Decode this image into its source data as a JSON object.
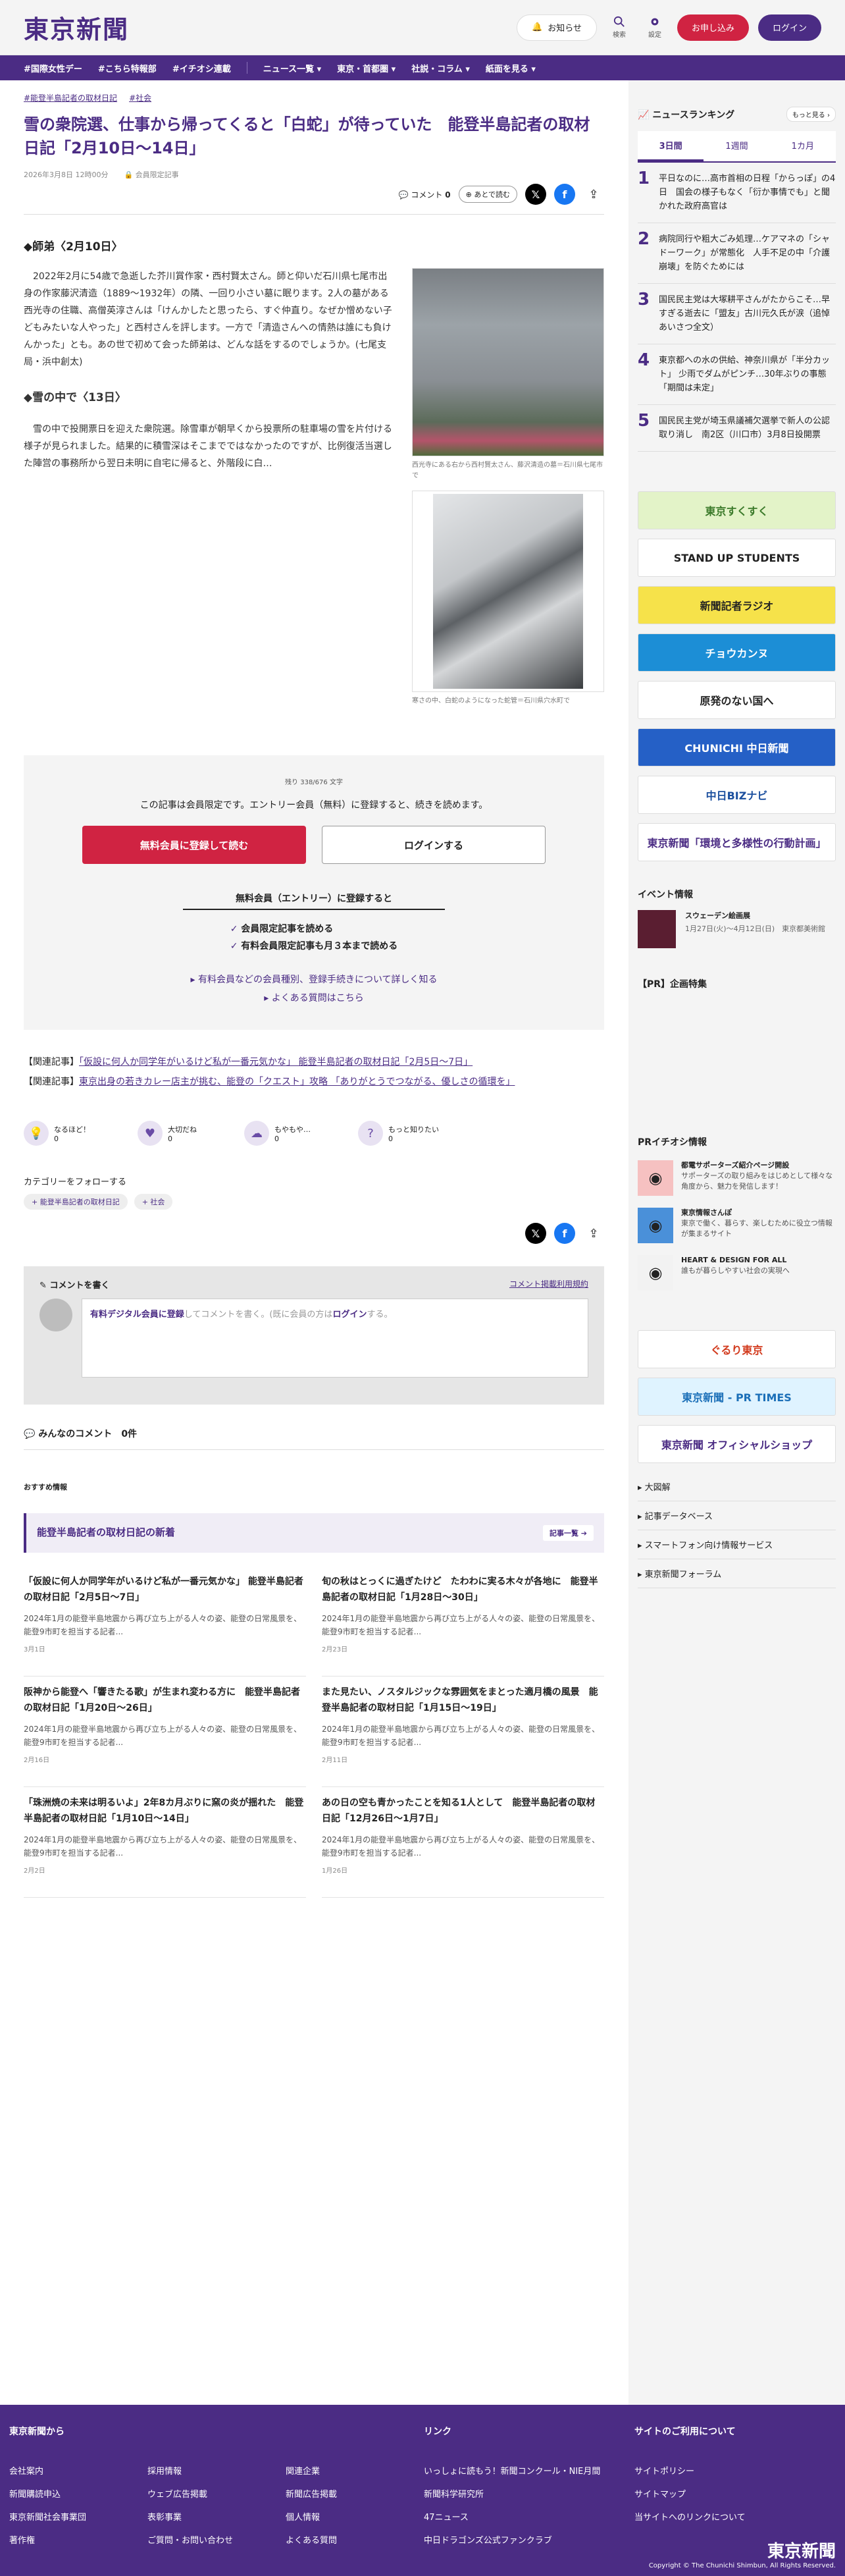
{
  "header": {
    "logo": "東京新聞",
    "notify": "お知らせ",
    "search": "検索",
    "settings": "設定",
    "register": "お申し込み",
    "login": "ログイン"
  },
  "nav": [
    "#国際女性デー",
    "#こちら特報部",
    "#イチオシ連載",
    "ニュース一覧 ▾",
    "東京・首都圏 ▾",
    "社説・コラム ▾",
    "紙面を見る ▾"
  ],
  "article": {
    "tags": [
      "#能登半島記者の取材日記",
      "#社会"
    ],
    "title": "雪の衆院選、仕事から帰ってくると「白蛇」が待っていた　能登半島記者の取材日記「2月10日〜14日」",
    "date": "2026年3月8日 12時00分",
    "members_only": "会員限定記事",
    "comment_label": "コメント",
    "comment_count": "0",
    "read_later": "あとで読む",
    "section1": "◆師弟〈2月10日〉",
    "para1": "　2022年2月に54歳で急逝した芥川賞作家・西村賢太さん。師と仰いだ石川県七尾市出身の作家藤沢清造（1889〜1932年）の隣、一回り小さい墓に眠ります。2人の墓がある西光寺の住職、高僧英淳さんは「けんかしたと思ったら、すぐ仲直り。なぜか憎めない子どもみたいな人やった」と西村さんを評します。一方で「清造さんへの情熱は誰にも負けんかった」とも。あの世で初めて会った師弟は、どんな話をするのでしょうか。(七尾支局・浜中創太)",
    "section2": "◆雪の中で〈13日〉",
    "para2": "　雪の中で投開票日を迎えた衆院選。除雪車が朝早くから投票所の駐車場の雪を片付ける様子が見られました。結果的に積雪深はそこまでではなかったのですが、比例復活当選した陣営の事務所から翌日未明に自宅に帰ると、外階段に白…",
    "cap1": "西光寺にある右から西村賢太さん、藤沢清造の墓＝石川県七尾市で",
    "cap2": "寒さの中、白蛇のようになった蛇管＝石川県穴水町で"
  },
  "paywall": {
    "count": "残り 338/676 文字",
    "msg": "この記事は会員限定です。エントリー会員（無料）に登録すると、続きを読めます。",
    "register": "無料会員に登録して読む",
    "login": "ログインする",
    "heading": "無料会員（エントリー）に登録すると",
    "benefits": [
      "会員限定記事を読める",
      "有料会員限定記事も月３本まで読める"
    ],
    "links": [
      "▸ 有料会員などの会員種別、登録手続きについて詳しく知る",
      "▸ よくある質問はこちら"
    ]
  },
  "related": [
    {
      "label": "【関連記事】",
      "text": "「仮設に何人か同学年がいるけど私が一番元気かな」 能登半島記者の取材日記「2月5日〜7日」"
    },
    {
      "label": "【関連記事】",
      "text": "東京出身の若きカレー店主が挑む、能登の「クエスト」攻略 「ありがとうでつながる、優しさの循環を」"
    }
  ],
  "reactions": [
    {
      "label": "なるほど！",
      "count": "0",
      "icon": "lightbulb-icon"
    },
    {
      "label": "大切だね",
      "count": "0",
      "icon": "heart-icon"
    },
    {
      "label": "もやもや…",
      "count": "0",
      "icon": "cloud-icon"
    },
    {
      "label": "もっと知りたい",
      "count": "0",
      "icon": "question-icon"
    }
  ],
  "follow": {
    "title": "カテゴリーをフォローする",
    "chips": [
      "+ 能登半島記者の取材日記",
      "+ 社会"
    ]
  },
  "comment_box": {
    "title": "コメントを書く",
    "rules": "コメント掲載利用規約",
    "prompt_link": "有料デジタル会員に登録",
    "prompt_mid": "してコメントを書く。(既に会員の方は",
    "prompt_login": "ログイン",
    "prompt_end": "する。"
  },
  "all_comments": {
    "label": "みんなのコメント",
    "count": "0件"
  },
  "recommend": "おすすめ情報",
  "series": {
    "title": "能登半島記者の取材日記の新着",
    "link": "記事一覧 ➔"
  },
  "cards": [
    {
      "title": "「仮設に何人か同学年がいるけど私が一番元気かな」 能登半島記者の取材日記「2月5日〜7日」",
      "desc": "2024年1月の能登半島地震から再び立ち上がる人々の姿、能登の日常風景を、能登9市町を担当する記者...",
      "date": "3月1日"
    },
    {
      "title": "旬の秋はとっくに過ぎたけど　たわわに実る木々が各地に　能登半島記者の取材日記「1月28日〜30日」",
      "desc": "2024年1月の能登半島地震から再び立ち上がる人々の姿、能登の日常風景を、能登9市町を担当する記者...",
      "date": "2月23日"
    },
    {
      "title": "阪神から能登へ「響きたる歌」が生まれ変わる方に　能登半島記者の取材日記「1月20日〜26日」",
      "desc": "2024年1月の能登半島地震から再び立ち上がる人々の姿、能登の日常風景を、能登9市町を担当する記者...",
      "date": "2月16日"
    },
    {
      "title": "また見たい、ノスタルジックな雰囲気をまとった適月橋の風景　能登半島記者の取材日記「1月15日〜19日」",
      "desc": "2024年1月の能登半島地震から再び立ち上がる人々の姿、能登の日常風景を、能登9市町を担当する記者...",
      "date": "2月11日"
    },
    {
      "title": "「珠洲焼の未来は明るいよ」2年8カ月ぶりに窯の炎が揺れた　能登半島記者の取材日記「1月10日〜14日」",
      "desc": "2024年1月の能登半島地震から再び立ち上がる人々の姿、能登の日常風景を、能登9市町を担当する記者...",
      "date": "2月2日"
    },
    {
      "title": "あの日の空も青かったことを知る1人として　能登半島記者の取材日記「12月26日〜1月7日」",
      "desc": "2024年1月の能登半島地震から再び立ち上がる人々の姿、能登の日常風景を、能登9市町を担当する記者...",
      "date": "1月26日"
    }
  ],
  "sidebar": {
    "ranking_title": "ニュースランキング",
    "ranking_more": "もっと見る ›",
    "tabs": [
      "3日間",
      "1週間",
      "1カ月"
    ],
    "ranking": [
      {
        "n": "1",
        "text": "平日なのに…高市首相の日程「からっぽ」の4日　国会の様子もなく「衍か事情でも」と聞かれた政府高官は"
      },
      {
        "n": "2",
        "text": "病院同行や粗大ごみ処理…ケアマネの「シャドーワーク」が常態化　人手不足の中「介護崩壊」を防ぐためには"
      },
      {
        "n": "3",
        "text": "国民民主党は大塚耕平さんがたからこそ…早すぎる逝去に「盟友」古川元久氏が涙（追悼あいさつ全文）"
      },
      {
        "n": "4",
        "text": "東京都への水の供給、神奈川県が「半分カット」 少雨でダムがピンチ…30年ぶりの事態「期間は未定」"
      },
      {
        "n": "5",
        "text": "国民民主党が埼玉県議補欠選挙で新人の公認取り消し　南2区（川口市）3月8日投開票"
      }
    ],
    "banners": [
      {
        "text": "東京すくすく",
        "bg": "#e3f3c8",
        "fg": "#3b7a2a"
      },
      {
        "text": "STAND UP STUDENTS",
        "bg": "#ffffff",
        "fg": "#222222"
      },
      {
        "text": "新聞記者ラジオ",
        "bg": "#f6e24a",
        "fg": "#222222"
      },
      {
        "text": "チョウカンヌ",
        "bg": "#1c8ed6",
        "fg": "#ffffff"
      },
      {
        "text": "原発のない国へ",
        "bg": "#ffffff",
        "fg": "#222222"
      },
      {
        "text": "CHUNICHI 中日新聞",
        "bg": "#2560c6",
        "fg": "#ffffff"
      },
      {
        "text": "中日BIZナビ",
        "bg": "#ffffff",
        "fg": "#1b4f9e"
      },
      {
        "text": "東京新聞「環境と多様性の行動計画」",
        "bg": "#ffffff",
        "fg": "#4b2c84"
      }
    ],
    "event_title": "イベント情報",
    "event": {
      "name": "スウェーデン絵画展",
      "detail": "1月27日(火)〜4月12日(日)　東京都美術館"
    },
    "pr_feature": "【PR】企画特集",
    "pr_title": "PRイチオシ情報",
    "pr": [
      {
        "title": "都電サポーターズ紹介ページ開設",
        "desc": "サポーターズの取り組みをはじめとして様々な角度から、魅力を発信します！",
        "icon": "tram-icon",
        "color": "#f6c1c1"
      },
      {
        "title": "東京情報さんぽ",
        "desc": "東京で働く、暮らす、楽しむために役立つ情報が集まるサイト",
        "icon": "info-icon",
        "color": "#4a90d9"
      },
      {
        "title": "HEART & DESIGN FOR ALL",
        "desc": "誰もが暮らしやすい社会の実現へ",
        "icon": "flower-icon",
        "color": "#f2f2f2"
      }
    ],
    "banners2": [
      {
        "text": "ぐるり東京",
        "bg": "#ffffff",
        "fg": "#d23a1d"
      },
      {
        "text": "東京新聞 - PR TIMES",
        "bg": "#dff3ff",
        "fg": "#1b6fb8"
      },
      {
        "text": "東京新聞 オフィシャルショップ",
        "bg": "#ffffff",
        "fg": "#4b2c84"
      }
    ],
    "links": [
      "大図解",
      "記事データベース",
      "スマートフォン向け情報サービス",
      "東京新聞フォーラム"
    ]
  },
  "footer": {
    "cols": [
      {
        "title": "東京新聞から",
        "items": [
          "会社案内",
          "新聞購読申込",
          "東京新聞社会事業団",
          "著作権",
          "採用情報",
          "ウェブ広告掲載",
          "表彰事業",
          "ご質問・お問い合わせ",
          "関連企業",
          "新聞広告掲載",
          "個人情報",
          "よくある質問"
        ]
      },
      {
        "title": "リンク",
        "items": [
          "いっしょに読もう！新聞コンクール・NIE月間",
          "新聞科学研究所",
          "47ニュース",
          "中日ドラゴンズ公式ファンクラブ"
        ]
      },
      {
        "title": "サイトのご利用について",
        "items": [
          "サイトポリシー",
          "サイトマップ",
          "当サイトへのリンクについて"
        ]
      }
    ],
    "logo": "東京新聞",
    "copyright": "Copyright © The Chunichi Shimbun, All Rights Reserved."
  }
}
